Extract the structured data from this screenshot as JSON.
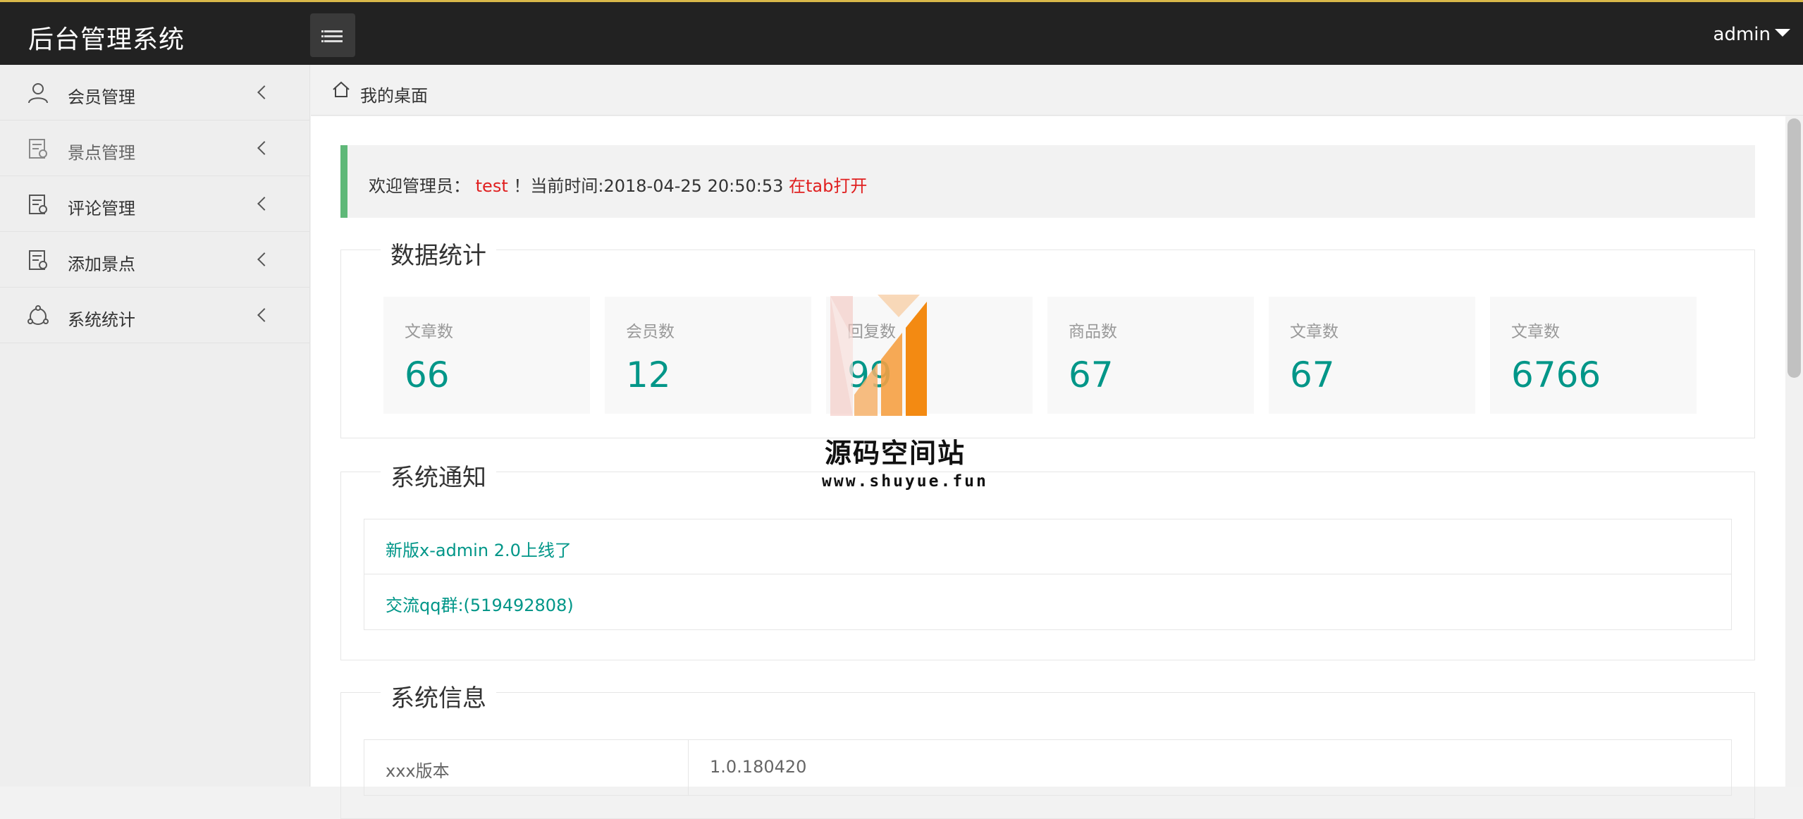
{
  "header": {
    "logo": "后台管理系统",
    "user": "admin"
  },
  "sidebar": {
    "items": [
      {
        "label": "会员管理",
        "icon": "user-icon"
      },
      {
        "label": "景点管理",
        "icon": "document-icon"
      },
      {
        "label": "评论管理",
        "icon": "document-icon"
      },
      {
        "label": "添加景点",
        "icon": "document-icon"
      },
      {
        "label": "系统统计",
        "icon": "stats-icon"
      }
    ]
  },
  "breadcrumb": {
    "label": "我的桌面"
  },
  "welcome": {
    "prefix": "欢迎管理员：",
    "name": "test",
    "middle": "！当前时间:2018-04-25 20:50:53 ",
    "link": "在tab打开"
  },
  "stats": {
    "title": "数据统计",
    "cards": [
      {
        "label": "文章数",
        "value": "66"
      },
      {
        "label": "会员数",
        "value": "12"
      },
      {
        "label": "回复数",
        "value": "99"
      },
      {
        "label": "商品数",
        "value": "67"
      },
      {
        "label": "文章数",
        "value": "67"
      },
      {
        "label": "文章数",
        "value": "6766"
      }
    ]
  },
  "notices": {
    "title": "系统通知",
    "items": [
      "新版x-admin 2.0上线了",
      "交流qq群:(519492808)"
    ]
  },
  "sysinfo": {
    "title": "系统信息",
    "rows": [
      {
        "key": "xxx版本",
        "value": "1.0.180420"
      }
    ]
  },
  "watermark": {
    "text": "源码空间站",
    "url": "www.shuyue.fun"
  },
  "colors": {
    "accent": "#009688",
    "topbar": "#222222",
    "highlight": "#e02020",
    "welcome_border": "#5fb878"
  }
}
